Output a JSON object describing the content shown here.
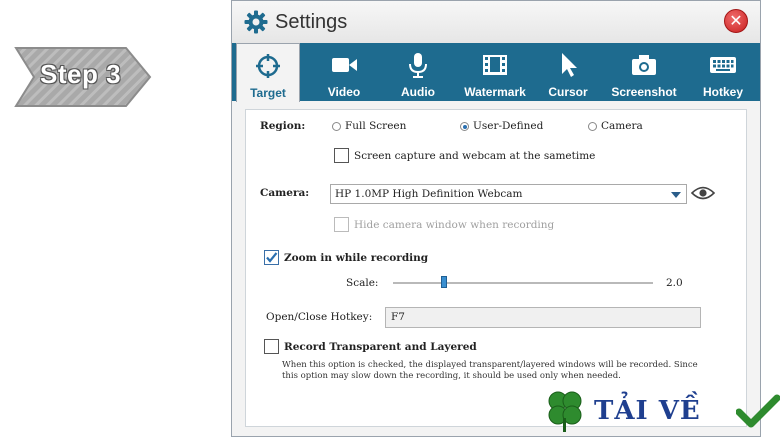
{
  "step_badge": {
    "label": "Step 3"
  },
  "window": {
    "title": "Settings",
    "close_symbol": "✕"
  },
  "tabs": [
    {
      "label": "Target",
      "icon": "target-icon",
      "active": true
    },
    {
      "label": "Video",
      "icon": "video-camera-icon"
    },
    {
      "label": "Audio",
      "icon": "microphone-icon"
    },
    {
      "label": "Watermark",
      "icon": "film-icon"
    },
    {
      "label": "Cursor",
      "icon": "cursor-icon"
    },
    {
      "label": "Screenshot",
      "icon": "camera-icon"
    },
    {
      "label": "Hotkey",
      "icon": "keyboard-icon"
    }
  ],
  "target": {
    "region_label": "Region:",
    "region_options": [
      "Full Screen",
      "User-Defined",
      "Camera"
    ],
    "region_selected": "User-Defined",
    "screen_webcam_label": "Screen capture and webcam at the sametime",
    "screen_webcam_checked": false,
    "camera_label": "Camera:",
    "camera_value": "HP 1.0MP High Definition Webcam",
    "hide_camera_label": "Hide camera window when recording",
    "hide_camera_checked": false,
    "zoom_label": "Zoom in while recording",
    "zoom_checked": true,
    "scale_label": "Scale:",
    "scale_value": "2.0",
    "hotkey_label": "Open/Close Hotkey:",
    "hotkey_value": "F7",
    "record_layered_label": "Record Transparent and Layered",
    "record_layered_checked": false,
    "record_layered_note": "When this option is checked, the displayed transparent/layered windows will be recorded. Since this option may slow down the recording, it should be used only when needed."
  },
  "watermark_logo": {
    "text": "TẢI VỀ"
  },
  "colors": {
    "tabbar": "#1e6b8f",
    "accent": "#2a6fb0",
    "close": "#d62b2b"
  }
}
